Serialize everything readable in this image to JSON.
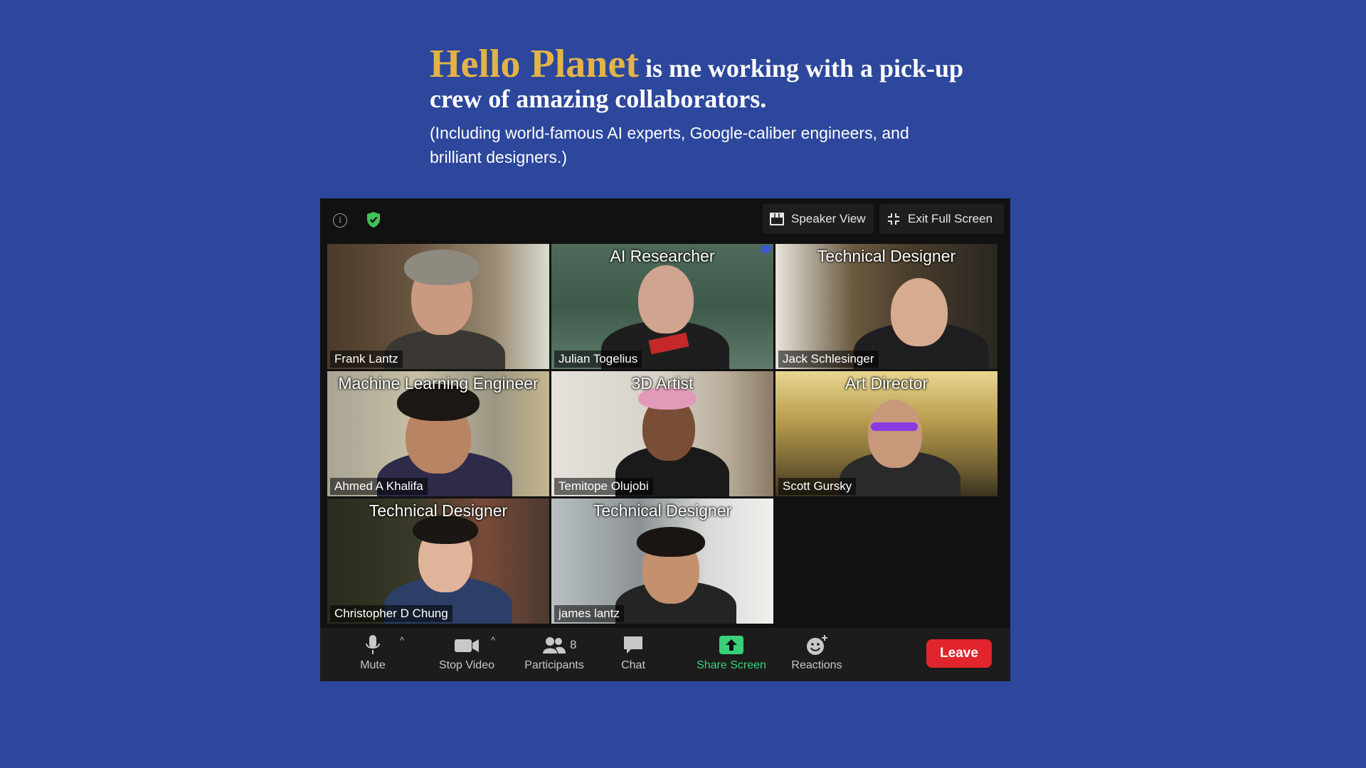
{
  "intro": {
    "brand": "Hello Planet",
    "headline_rest": " is me working with a pick-up crew of amazing collaborators.",
    "subline": "(Including world-famous AI experts, Google-caliber engineers, and brilliant designers.)"
  },
  "topbar": {
    "speaker_view": "Speaker View",
    "exit_full_screen": "Exit Full Screen"
  },
  "tiles": [
    {
      "name": "Frank Lantz",
      "role": ""
    },
    {
      "name": "Julian Togelius",
      "role": "AI Researcher"
    },
    {
      "name": "Jack Schlesinger",
      "role": "Technical Designer"
    },
    {
      "name": "Ahmed A Khalifa",
      "role": "Machine Learning Engineer"
    },
    {
      "name": "Temitope Olujobi",
      "role": "3D Artist"
    },
    {
      "name": "Scott Gursky",
      "role": "Art Director"
    },
    {
      "name": "Christopher D Chung",
      "role": "Technical Designer"
    },
    {
      "name": "james lantz",
      "role": "Technical Designer"
    }
  ],
  "toolbar": {
    "mute": "Mute",
    "stop_video": "Stop Video",
    "participants": "Participants",
    "participant_count": "8",
    "chat": "Chat",
    "share_screen": "Share Screen",
    "reactions": "Reactions",
    "leave": "Leave"
  },
  "colors": {
    "page_background": "#2c479b",
    "brand_gold": "#e3b347",
    "share_green": "#3ad07a",
    "leave_red": "#e0262c",
    "active_speaker_border": "#7bb85e"
  },
  "icons": [
    "info-icon",
    "shield-check-icon",
    "grid-icon",
    "exit-fullscreen-icon",
    "microphone-icon",
    "camera-icon",
    "participants-icon",
    "chat-icon",
    "share-screen-icon",
    "reactions-icon"
  ]
}
